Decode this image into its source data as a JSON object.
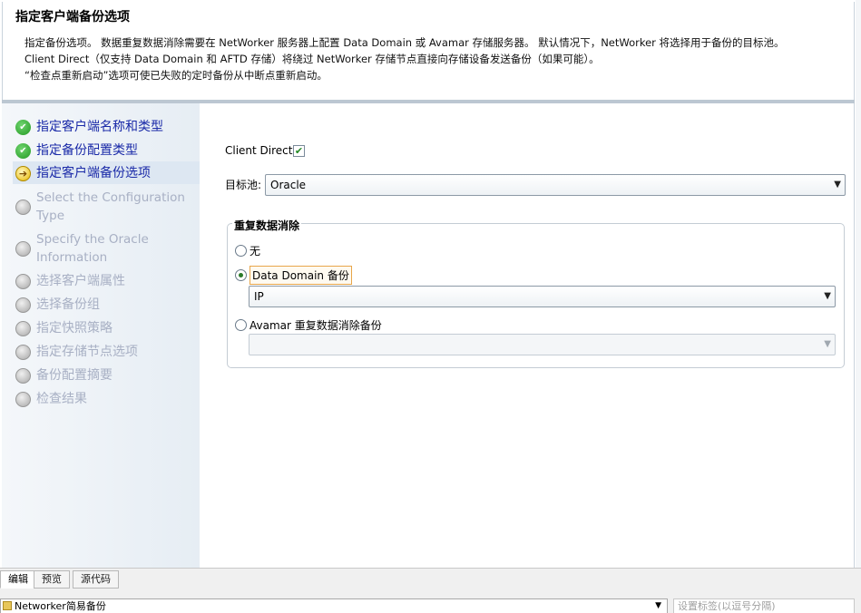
{
  "header": {
    "title": "指定客户端备份选项",
    "desc_line1": "指定备份选项。 数据重复数据消除需要在 NetWorker 服务器上配置 Data Domain 或 Avamar 存储服务器。 默认情况下，NetWorker 将选择用于备份的目标池。",
    "desc_line2": "Client Direct（仅支持 Data Domain 和 AFTD 存储）将绕过 NetWorker 存储节点直接向存储设备发送备份（如果可能）。",
    "desc_line3": "“检查点重新启动”选项可使已失败的定时备份从中断点重新启动。"
  },
  "steps": [
    {
      "label": "指定客户端名称和类型",
      "state": "done"
    },
    {
      "label": "指定备份配置类型",
      "state": "done"
    },
    {
      "label": "指定客户端备份选项",
      "state": "current"
    },
    {
      "label_a": "Select the Configuration",
      "label_b": "Type",
      "state": "todo"
    },
    {
      "label_a": "Specify the Oracle",
      "label_b": "Information",
      "state": "todo"
    },
    {
      "label": "选择客户端属性",
      "state": "todo"
    },
    {
      "label": "选择备份组",
      "state": "todo"
    },
    {
      "label": "指定快照策略",
      "state": "todo"
    },
    {
      "label": "指定存储节点选项",
      "state": "todo"
    },
    {
      "label": "备份配置摘要",
      "state": "todo"
    },
    {
      "label": "检查结果",
      "state": "todo"
    }
  ],
  "form": {
    "client_direct_label": "Client Direct:",
    "client_direct_checked": true,
    "target_pool_label": "目标池:",
    "target_pool_value": "Oracle",
    "dedup_legend": "重复数据消除",
    "option_none": "无",
    "option_dd": "Data Domain 备份",
    "dd_value": "IP",
    "option_avamar": "Avamar 重复数据消除备份",
    "avamar_value": "",
    "selected_option": "dd"
  },
  "bottom": {
    "tab_edit": "编辑",
    "tab_preview": "预览",
    "tab_source": "源代码",
    "post_select_value": "Networker简易备份",
    "tags_placeholder": "设置标签(以逗号分隔)"
  },
  "colors": {
    "step_active": "#1a2aa8",
    "step_pending": "#a8b0c4",
    "sidebar": "#e6edf4",
    "focus_border": "#e8a64a"
  }
}
